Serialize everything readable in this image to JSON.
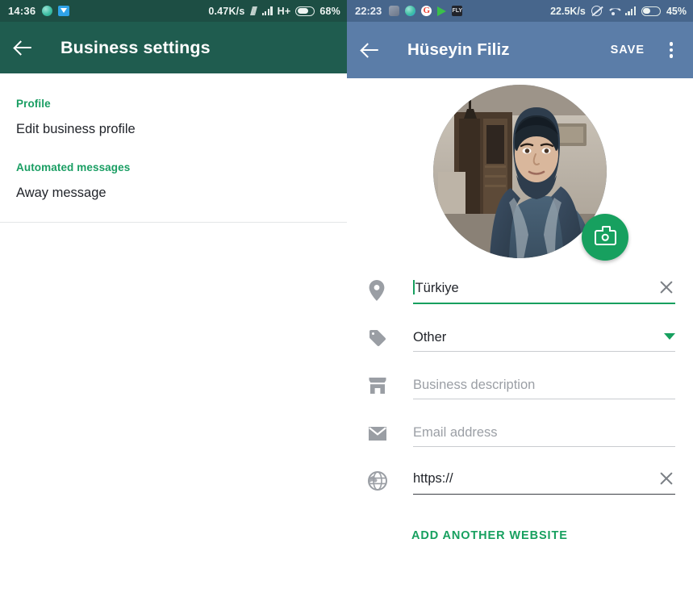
{
  "left_pane": {
    "status_bar": {
      "clock": "14:36",
      "network_rate": "0.47K/s",
      "network_type": "H+",
      "battery": "68%",
      "icons": [
        "whatsapp-circle-icon",
        "download-icon",
        "data-transfer-icon",
        "signal-bars-icon",
        "battery-icon"
      ]
    },
    "app_bar": {
      "back_icon": "back-arrow-icon",
      "title": "Business settings"
    },
    "sections": [
      {
        "header": "Profile",
        "rows": [
          "Edit business profile"
        ]
      },
      {
        "header": "Automated messages",
        "rows": [
          "Away message"
        ]
      }
    ]
  },
  "right_pane": {
    "status_bar": {
      "clock": "22:23",
      "network_rate": "22.5K/s",
      "battery": "45%",
      "g_letter": "G",
      "dark_app_letter": "FLY",
      "icons": [
        "app-gray-icon",
        "app-teal-icon",
        "google-icon",
        "play-store-icon",
        "app-dark-icon",
        "alarm-off-icon",
        "wifi-icon",
        "signal-bars-icon",
        "battery-icon"
      ]
    },
    "app_bar": {
      "back_icon": "back-arrow-icon",
      "title": "Hüseyin Filiz",
      "save_label": "SAVE",
      "overflow_icon": "kebab-menu-icon"
    },
    "avatar": {
      "name": "profile-photo",
      "camera_button_icon": "camera-icon"
    },
    "fields": [
      {
        "id": "location",
        "icon": "location-pin-icon",
        "value": "Türkiye",
        "placeholder": "",
        "focused": true,
        "has_clear": true,
        "has_dropdown": false
      },
      {
        "id": "category",
        "icon": "tag-icon",
        "value": "Other",
        "placeholder": "",
        "focused": false,
        "has_clear": false,
        "has_dropdown": true
      },
      {
        "id": "description",
        "icon": "storefront-icon",
        "value": "",
        "placeholder": "Business description",
        "focused": false,
        "has_clear": false,
        "has_dropdown": false
      },
      {
        "id": "email",
        "icon": "envelope-icon",
        "value": "",
        "placeholder": "Email address",
        "focused": false,
        "has_clear": false,
        "has_dropdown": false
      },
      {
        "id": "website",
        "icon": "globe-icon",
        "value": "https://",
        "placeholder": "",
        "focused": false,
        "has_clear": true,
        "has_dropdown": false
      }
    ],
    "add_website_label": "ADD ANOTHER WEBSITE"
  },
  "colors": {
    "left_status_bar": "#1d4e44",
    "left_app_bar": "#1f5c4f",
    "right_status_bar": "#47668c",
    "right_app_bar": "#5b7da8",
    "accent_green": "#17a05f",
    "section_header_green": "#1a9e63",
    "text_primary": "#22252b",
    "text_placeholder": "#9b9fa5",
    "underline_gray": "#c9ccd0"
  }
}
